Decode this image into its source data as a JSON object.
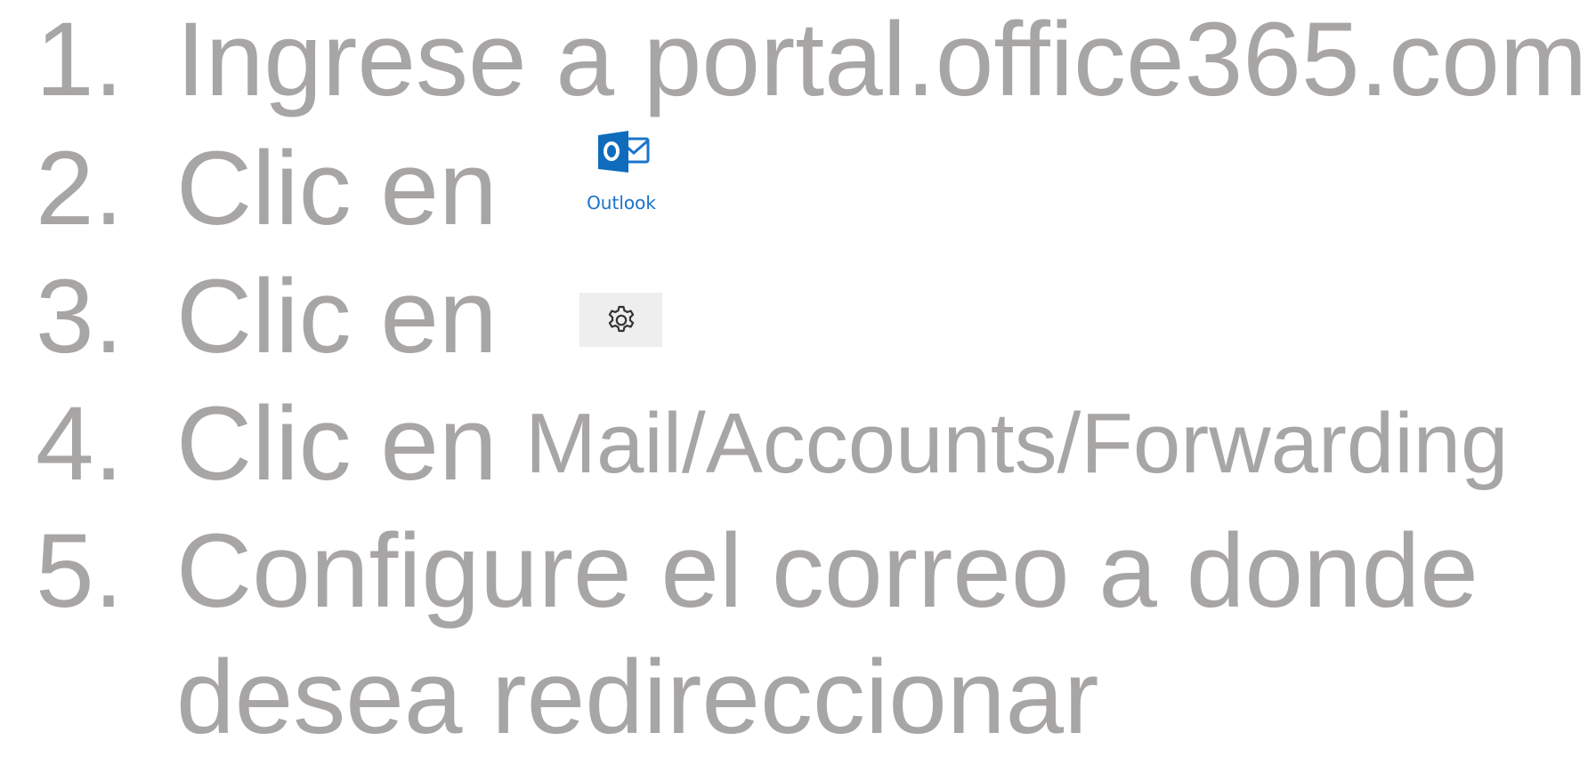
{
  "steps": [
    {
      "number": "1.",
      "text": "Ingrese a portal.office365.com"
    },
    {
      "number": "2.",
      "text": "Clic en"
    },
    {
      "number": "3.",
      "text": "Clic en"
    },
    {
      "number": "4.",
      "text": "Clic en",
      "path": "Mail/Accounts/Forwarding"
    },
    {
      "number": "5.",
      "text": "Configure el correo a donde",
      "continuation": "desea redireccionar"
    }
  ],
  "outlook_button": {
    "label": "Outlook",
    "icon": "outlook-icon",
    "brand_color": "#0f6cbd"
  },
  "settings_button": {
    "icon": "gear-icon"
  },
  "colors": {
    "text": "#a8a5a5",
    "link_blue": "#1a73c9"
  }
}
